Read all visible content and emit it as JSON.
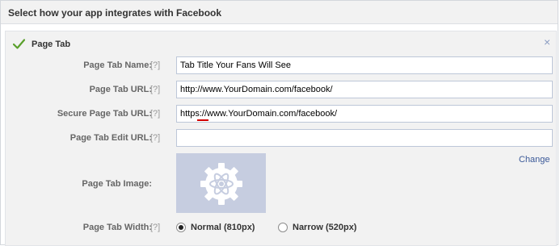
{
  "header": {
    "title": "Select how your app integrates with Facebook"
  },
  "panel": {
    "title": "Page Tab",
    "close_glyph": "×",
    "help": "[?]",
    "fields": {
      "name": {
        "label": "Page Tab Name:",
        "value": "Tab Title Your Fans Will See"
      },
      "url": {
        "label": "Page Tab URL:",
        "value": "http://www.YourDomain.com/facebook/"
      },
      "secure_url": {
        "label": "Secure Page Tab URL:",
        "value": "https://www.YourDomain.com/facebook/"
      },
      "edit_url": {
        "label": "Page Tab Edit URL:",
        "value": ""
      }
    },
    "image": {
      "label": "Page Tab Image:",
      "change_link": "Change",
      "placeholder_icon": "atom-gear-icon"
    },
    "width": {
      "label": "Page Tab Width:",
      "options": [
        {
          "label": "Normal (810px)",
          "selected": true
        },
        {
          "label": "Narrow (520px)",
          "selected": false
        }
      ]
    }
  },
  "colors": {
    "link": "#3b5998",
    "check": "#5aa02c",
    "input_border": "#bdc7d8",
    "image_bg": "#c6cde0",
    "spell_error": "#d20000"
  }
}
